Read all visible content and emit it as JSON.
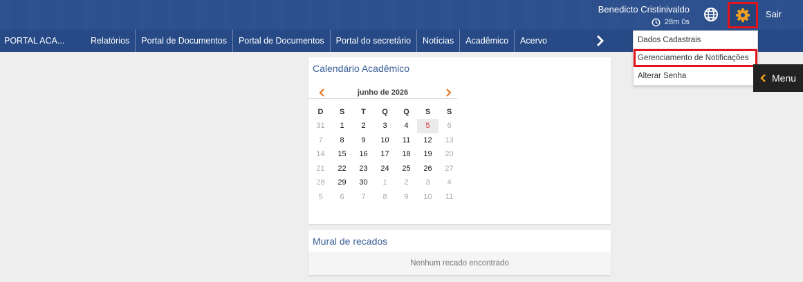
{
  "header": {
    "user_name": "Benedicto Cristinivaldo",
    "session_time": "28m 0s",
    "logout_label": "Sair",
    "icons": [
      "clock-icon",
      "globe-icon",
      "gear-icon"
    ],
    "colors": {
      "bar": "#2b4f8c",
      "highlight": "#e3121b",
      "gear": "#f0a020"
    }
  },
  "nav": {
    "brand": "PORTAL ACA...",
    "items": [
      "Relatórios",
      "Portal de Documentos",
      "Portal de Documentos",
      "Portal do secretário",
      "Notícias",
      "Acadêmico",
      "Acervo"
    ],
    "next_icon": "chevron-right-icon"
  },
  "settings_menu": {
    "items": [
      "Dados Cadastrais",
      "Gerenciamento de Notificações",
      "Alterar Senha"
    ]
  },
  "side_menu": {
    "label": "Menu"
  },
  "calendar": {
    "title": "Calendário Acadêmico",
    "month_label": "junho de 2026",
    "weekdays": [
      "D",
      "S",
      "T",
      "Q",
      "Q",
      "S",
      "S"
    ],
    "days": [
      {
        "d": "31",
        "m": true
      },
      {
        "d": "1"
      },
      {
        "d": "2"
      },
      {
        "d": "3"
      },
      {
        "d": "4"
      },
      {
        "d": "5",
        "today": true
      },
      {
        "d": "6",
        "m": true
      },
      {
        "d": "7",
        "m": true
      },
      {
        "d": "8"
      },
      {
        "d": "9"
      },
      {
        "d": "10"
      },
      {
        "d": "11"
      },
      {
        "d": "12"
      },
      {
        "d": "13",
        "m": true
      },
      {
        "d": "14",
        "m": true
      },
      {
        "d": "15"
      },
      {
        "d": "16"
      },
      {
        "d": "17"
      },
      {
        "d": "18"
      },
      {
        "d": "19"
      },
      {
        "d": "20",
        "m": true
      },
      {
        "d": "21",
        "m": true
      },
      {
        "d": "22"
      },
      {
        "d": "23"
      },
      {
        "d": "24"
      },
      {
        "d": "25"
      },
      {
        "d": "26"
      },
      {
        "d": "27",
        "m": true
      },
      {
        "d": "28",
        "m": true
      },
      {
        "d": "29"
      },
      {
        "d": "30"
      },
      {
        "d": "1",
        "m": true
      },
      {
        "d": "2",
        "m": true
      },
      {
        "d": "3",
        "m": true
      },
      {
        "d": "4",
        "m": true
      },
      {
        "d": "5",
        "m": true
      },
      {
        "d": "6",
        "m": true
      },
      {
        "d": "7",
        "m": true
      },
      {
        "d": "8",
        "m": true
      },
      {
        "d": "9",
        "m": true
      },
      {
        "d": "10",
        "m": true
      },
      {
        "d": "11",
        "m": true
      }
    ]
  },
  "mural": {
    "title": "Mural de recados",
    "empty_text": "Nenhum recado encontrado"
  }
}
